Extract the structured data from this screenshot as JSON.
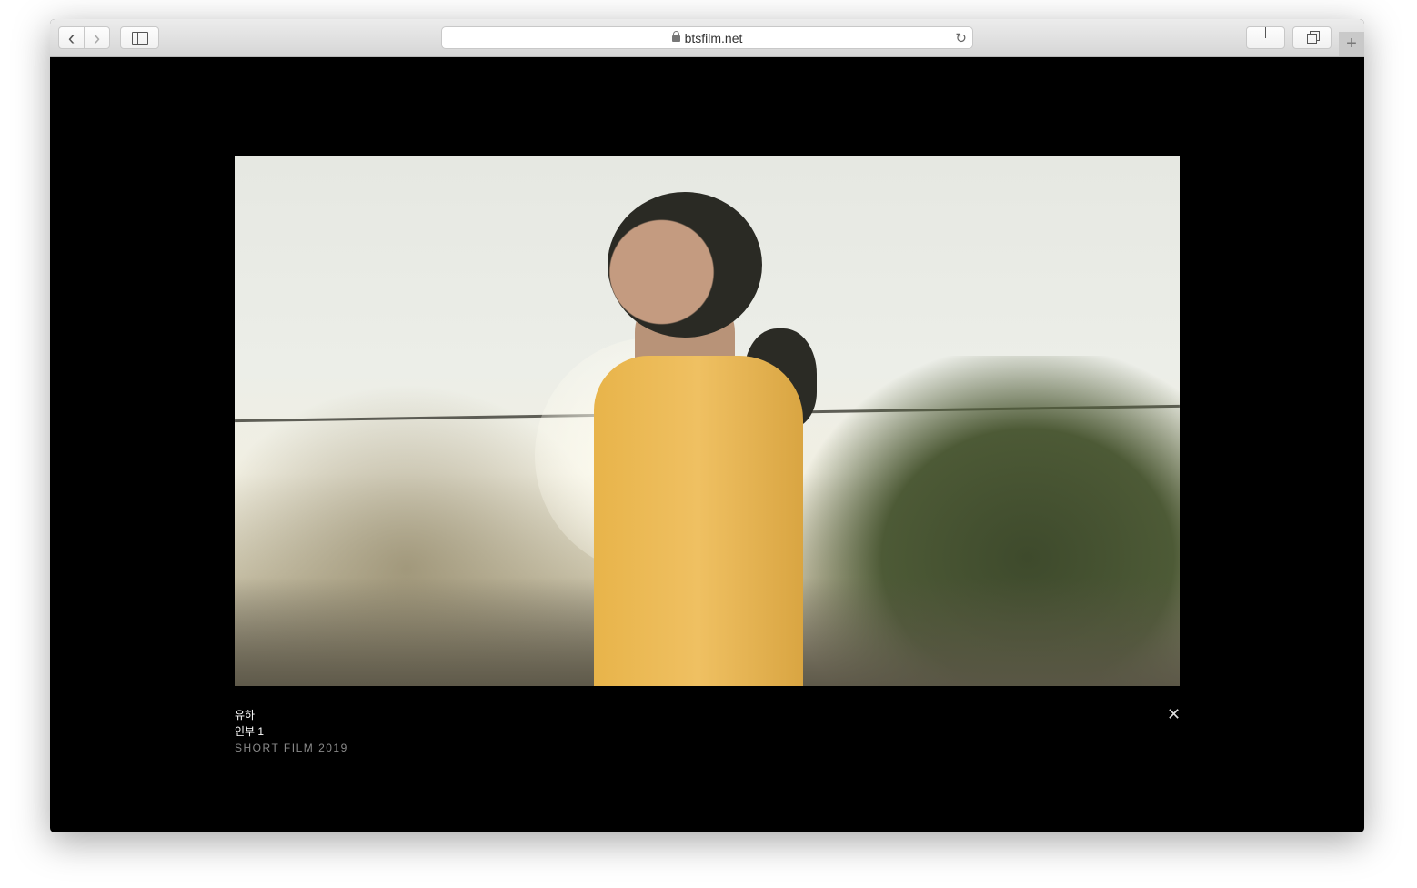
{
  "browser": {
    "url": "btsfilm.net",
    "icons": {
      "back": "chevron-left-icon",
      "forward": "chevron-right-icon",
      "sidebar": "sidebar-icon",
      "lock": "lock-icon",
      "reload": "reload-icon",
      "share": "share-icon",
      "tabs": "tabs-icon",
      "new_tab": "plus-icon"
    },
    "back_glyph": "‹",
    "forward_glyph": "›",
    "reload_glyph": "↻",
    "new_tab_glyph": "+"
  },
  "film": {
    "title": "유하",
    "subtitle": "인부 1",
    "category": "SHORT FILM 2019",
    "close_glyph": "✕"
  }
}
